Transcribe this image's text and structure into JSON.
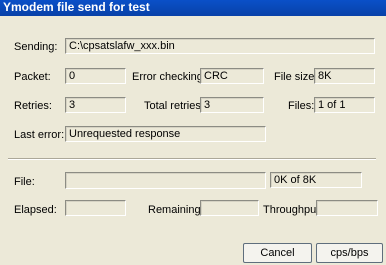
{
  "window": {
    "title": "Ymodem file send for test"
  },
  "sending": {
    "label": "Sending:",
    "value": "C:\\cpsatslafw_xxx.bin"
  },
  "packet": {
    "label": "Packet:",
    "value": "0"
  },
  "error_checking": {
    "label": "Error checking:",
    "value": "CRC"
  },
  "file_size": {
    "label": "File size:",
    "value": "8K"
  },
  "retries": {
    "label": "Retries:",
    "value": "3"
  },
  "total_retries": {
    "label": "Total retries:",
    "value": "3"
  },
  "files": {
    "label": "Files:",
    "value": "1 of 1"
  },
  "last_error": {
    "label": "Last error:",
    "value": "Unrequested response"
  },
  "file": {
    "label": "File:",
    "progress_text": "0K of 8K",
    "progress": 0
  },
  "elapsed": {
    "label": "Elapsed:",
    "value": ""
  },
  "remaining": {
    "label": "Remaining:",
    "value": ""
  },
  "throughput": {
    "label": "Throughput:",
    "value": ""
  },
  "buttons": {
    "cancel": "Cancel",
    "cps": "cps/bps"
  }
}
